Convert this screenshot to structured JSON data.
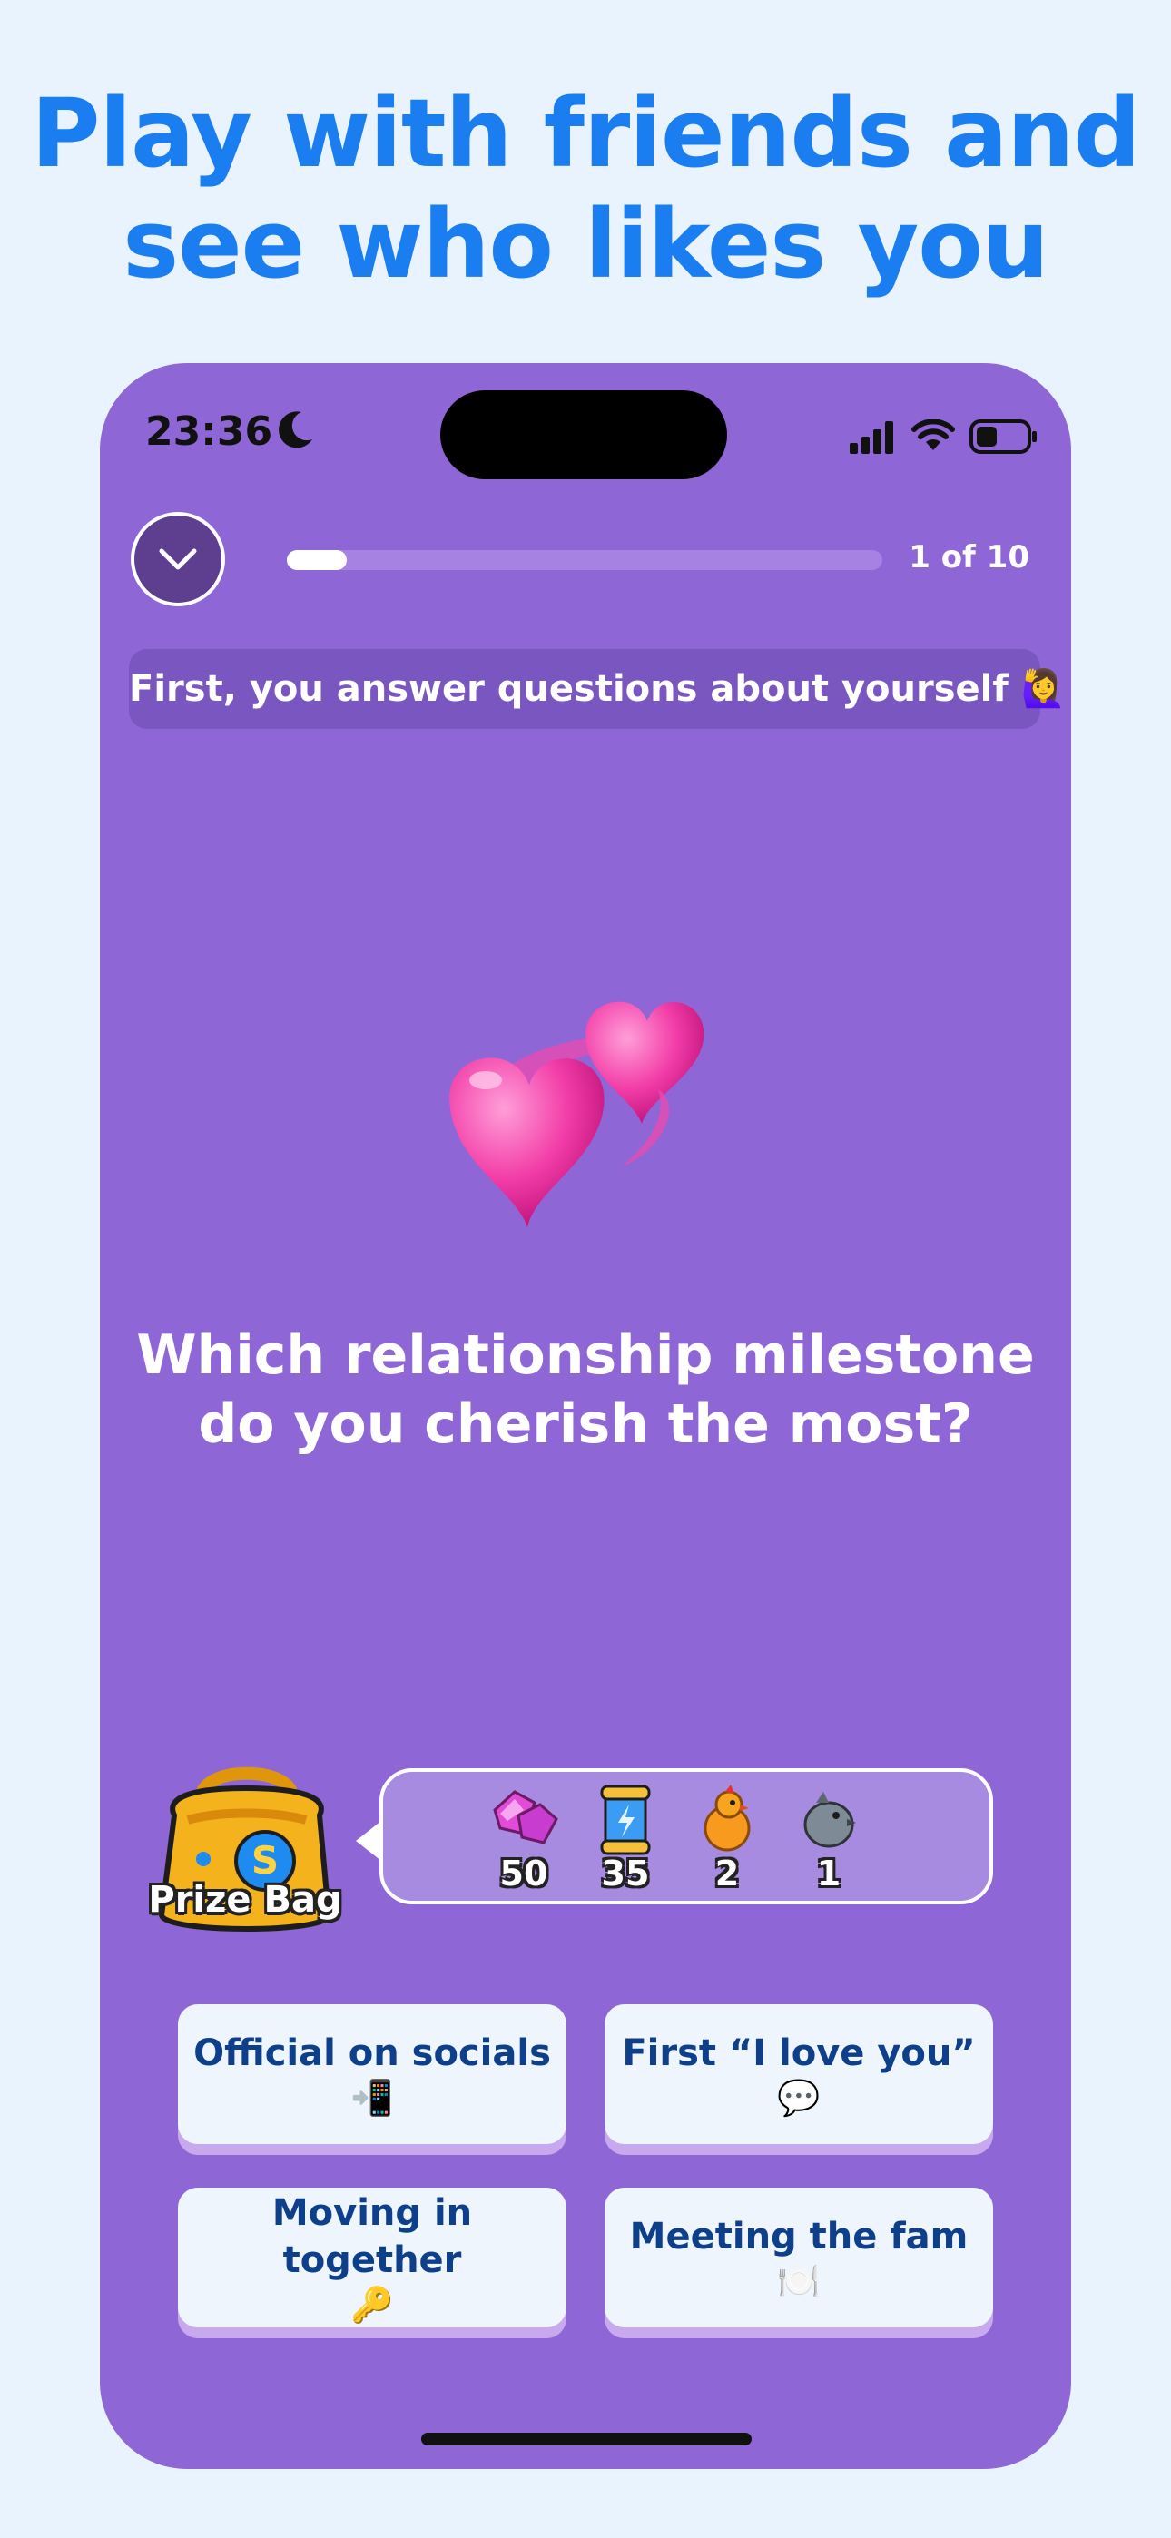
{
  "headline": {
    "line1": "Play with friends and",
    "line2": "see who likes you"
  },
  "status_bar": {
    "time": "23:36",
    "icons": [
      "moon-icon",
      "signal-icon",
      "wifi-icon",
      "battery-icon"
    ]
  },
  "progress": {
    "label": "1 of 10",
    "current": 1,
    "total": 10,
    "fraction": 0.1
  },
  "info_banner": "First, you answer questions about yourself 🙋‍♀️",
  "question": {
    "emoji": "💞",
    "text": "Which relationship milestone do you cherish the most?"
  },
  "prize": {
    "bag_label": "Prize Bag",
    "rewards": [
      {
        "icon": "gems-icon",
        "count": "50"
      },
      {
        "icon": "energy-canister-icon",
        "count": "35"
      },
      {
        "icon": "chick-icon",
        "count": "2"
      },
      {
        "icon": "gray-bird-icon",
        "count": "1"
      }
    ]
  },
  "answers": [
    {
      "label": "Official on socials",
      "emoji": "📲"
    },
    {
      "label": "First “I love you”",
      "emoji": "💬"
    },
    {
      "label": "Moving in together",
      "emoji": "🔑"
    },
    {
      "label": "Meeting the fam",
      "emoji": "🍽️"
    }
  ],
  "colors": {
    "background": "#e8f3fd",
    "headline": "#1a7df0",
    "phone": "#8f66d6",
    "answer_text": "#0d3f8a",
    "answer_bg": "#eef5fd"
  }
}
